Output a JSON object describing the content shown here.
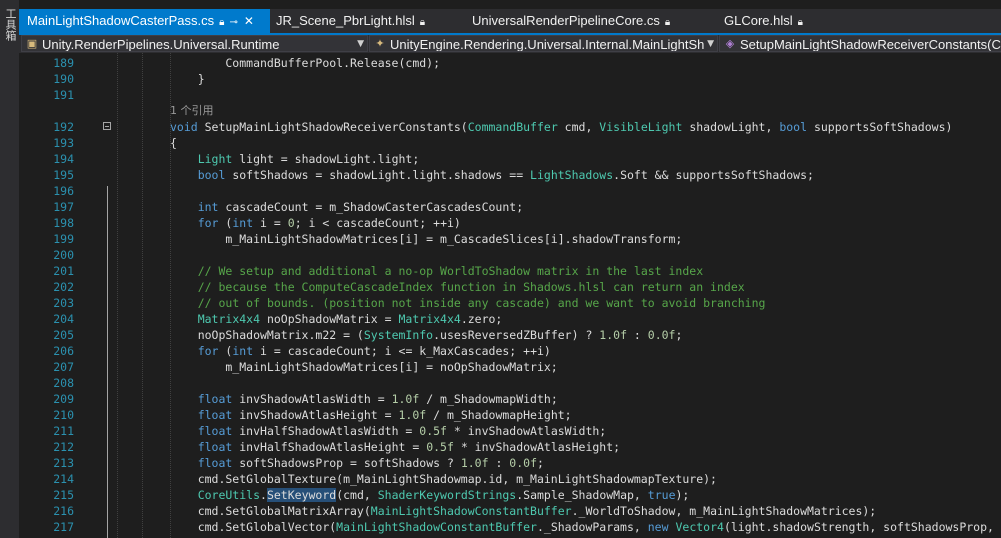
{
  "side_panel": {
    "label": "工具箱"
  },
  "tabs": [
    {
      "label": "MainLightShadowCasterPass.cs",
      "active": true,
      "pinned": true,
      "locked": true,
      "closable": true
    },
    {
      "label": "JR_Scene_PbrLight.hlsl",
      "active": false,
      "locked": true
    },
    {
      "label": "UniversalRenderPipelineCore.cs",
      "active": false,
      "locked": true
    },
    {
      "label": "GLCore.hlsl",
      "active": false,
      "locked": true
    }
  ],
  "navigation": {
    "project": "Unity.RenderPipelines.Universal.Runtime",
    "type": "UnityEngine.Rendering.Universal.Internal.MainLightSh",
    "member": "SetupMainLightShadowReceiverConstants(Co"
  },
  "reference_lens": "1 个引用",
  "code_lines": [
    {
      "n": "189",
      "tokens": [
        [
          "",
          "        CommandBufferPool.Release(cmd);"
        ]
      ]
    },
    {
      "n": "190",
      "tokens": [
        [
          "",
          "    }"
        ]
      ]
    },
    {
      "n": "191",
      "tokens": []
    },
    {
      "n": "192",
      "tokens": [
        [
          "kw",
          "void"
        ],
        [
          "",
          " SetupMainLightShadowReceiverConstants("
        ],
        [
          "ty",
          "CommandBuffer"
        ],
        [
          "",
          " cmd, "
        ],
        [
          "ty",
          "VisibleLight"
        ],
        [
          "",
          " shadowLight, "
        ],
        [
          "kw",
          "bool"
        ],
        [
          "",
          " supportsSoftShadows)"
        ]
      ]
    },
    {
      "n": "193",
      "tokens": [
        [
          "",
          "{"
        ]
      ]
    },
    {
      "n": "194",
      "tokens": [
        [
          "",
          "    "
        ],
        [
          "ty",
          "Light"
        ],
        [
          "",
          " light = shadowLight.light;"
        ]
      ]
    },
    {
      "n": "195",
      "tokens": [
        [
          "",
          "    "
        ],
        [
          "kw",
          "bool"
        ],
        [
          "",
          " softShadows = shadowLight.light.shadows == "
        ],
        [
          "ty",
          "LightShadows"
        ],
        [
          "",
          ".Soft && supportsSoftShadows;"
        ]
      ]
    },
    {
      "n": "196",
      "tokens": []
    },
    {
      "n": "197",
      "tokens": [
        [
          "",
          "    "
        ],
        [
          "kw",
          "int"
        ],
        [
          "",
          " cascadeCount = m_ShadowCasterCascadesCount;"
        ]
      ]
    },
    {
      "n": "198",
      "tokens": [
        [
          "",
          "    "
        ],
        [
          "kw",
          "for"
        ],
        [
          "",
          " ("
        ],
        [
          "kw",
          "int"
        ],
        [
          "",
          " i = "
        ],
        [
          "nm",
          "0"
        ],
        [
          "",
          "; i < cascadeCount; ++i)"
        ]
      ]
    },
    {
      "n": "199",
      "tokens": [
        [
          "",
          "        m_MainLightShadowMatrices[i] = m_CascadeSlices[i].shadowTransform;"
        ]
      ]
    },
    {
      "n": "200",
      "tokens": []
    },
    {
      "n": "201",
      "tokens": [
        [
          "",
          "    "
        ],
        [
          "cm",
          "// We setup and additional a no-op WorldToShadow matrix in the last index"
        ]
      ]
    },
    {
      "n": "202",
      "tokens": [
        [
          "",
          "    "
        ],
        [
          "cm",
          "// because the ComputeCascadeIndex function in Shadows.hlsl can return an index"
        ]
      ]
    },
    {
      "n": "203",
      "tokens": [
        [
          "",
          "    "
        ],
        [
          "cm",
          "// out of bounds. (position not inside any cascade) and we want to avoid branching"
        ]
      ]
    },
    {
      "n": "204",
      "tokens": [
        [
          "",
          "    "
        ],
        [
          "ty",
          "Matrix4x4"
        ],
        [
          "",
          " noOpShadowMatrix = "
        ],
        [
          "ty",
          "Matrix4x4"
        ],
        [
          "",
          ".zero;"
        ]
      ]
    },
    {
      "n": "205",
      "tokens": [
        [
          "",
          "    noOpShadowMatrix.m22 = ("
        ],
        [
          "ty",
          "SystemInfo"
        ],
        [
          "",
          ".usesReversedZBuffer) ? "
        ],
        [
          "nm",
          "1.0f"
        ],
        [
          "",
          " : "
        ],
        [
          "nm",
          "0.0f"
        ],
        [
          "",
          ";"
        ]
      ]
    },
    {
      "n": "206",
      "tokens": [
        [
          "",
          "    "
        ],
        [
          "kw",
          "for"
        ],
        [
          "",
          " ("
        ],
        [
          "kw",
          "int"
        ],
        [
          "",
          " i = cascadeCount; i <= k_MaxCascades; ++i)"
        ]
      ]
    },
    {
      "n": "207",
      "tokens": [
        [
          "",
          "        m_MainLightShadowMatrices[i] = noOpShadowMatrix;"
        ]
      ]
    },
    {
      "n": "208",
      "tokens": []
    },
    {
      "n": "209",
      "tokens": [
        [
          "",
          "    "
        ],
        [
          "kw",
          "float"
        ],
        [
          "",
          " invShadowAtlasWidth = "
        ],
        [
          "nm",
          "1.0f"
        ],
        [
          "",
          " / m_ShadowmapWidth;"
        ]
      ]
    },
    {
      "n": "210",
      "tokens": [
        [
          "",
          "    "
        ],
        [
          "kw",
          "float"
        ],
        [
          "",
          " invShadowAtlasHeight = "
        ],
        [
          "nm",
          "1.0f"
        ],
        [
          "",
          " / m_ShadowmapHeight;"
        ]
      ]
    },
    {
      "n": "211",
      "tokens": [
        [
          "",
          "    "
        ],
        [
          "kw",
          "float"
        ],
        [
          "",
          " invHalfShadowAtlasWidth = "
        ],
        [
          "nm",
          "0.5f"
        ],
        [
          "",
          " * invShadowAtlasWidth;"
        ]
      ]
    },
    {
      "n": "212",
      "tokens": [
        [
          "",
          "    "
        ],
        [
          "kw",
          "float"
        ],
        [
          "",
          " invHalfShadowAtlasHeight = "
        ],
        [
          "nm",
          "0.5f"
        ],
        [
          "",
          " * invShadowAtlasHeight;"
        ]
      ]
    },
    {
      "n": "213",
      "tokens": [
        [
          "",
          "    "
        ],
        [
          "kw",
          "float"
        ],
        [
          "",
          " softShadowsProp = softShadows ? "
        ],
        [
          "nm",
          "1.0f"
        ],
        [
          "",
          " : "
        ],
        [
          "nm",
          "0.0f"
        ],
        [
          "",
          ";"
        ]
      ]
    },
    {
      "n": "214",
      "tokens": [
        [
          "",
          "    cmd.SetGlobalTexture(m_MainLightShadowmap.id, m_MainLightShadowmapTexture);"
        ]
      ]
    },
    {
      "n": "215",
      "tokens": [
        [
          "",
          "    "
        ],
        [
          "ty",
          "CoreUtils"
        ],
        [
          "",
          "."
        ],
        [
          "hl",
          "SetKeyword"
        ],
        [
          "",
          "(cmd, "
        ],
        [
          "ty",
          "ShaderKeywordStrings"
        ],
        [
          "",
          ".Sample_ShadowMap, "
        ],
        [
          "kw",
          "true"
        ],
        [
          "",
          ");"
        ]
      ]
    },
    {
      "n": "216",
      "tokens": [
        [
          "",
          "    cmd.SetGlobalMatrixArray("
        ],
        [
          "ty",
          "MainLightShadowConstantBuffer"
        ],
        [
          "",
          "._WorldToShadow, m_MainLightShadowMatrices);"
        ]
      ]
    },
    {
      "n": "217",
      "tokens": [
        [
          "",
          "    cmd.SetGlobalVector("
        ],
        [
          "ty",
          "MainLightShadowConstantBuffer"
        ],
        [
          "",
          "._ShadowParams, "
        ],
        [
          "kw",
          "new"
        ],
        [
          "",
          " "
        ],
        [
          "ty",
          "Vector4"
        ],
        [
          "",
          "(light.shadowStrength, softShadowsProp,"
        ]
      ]
    }
  ]
}
